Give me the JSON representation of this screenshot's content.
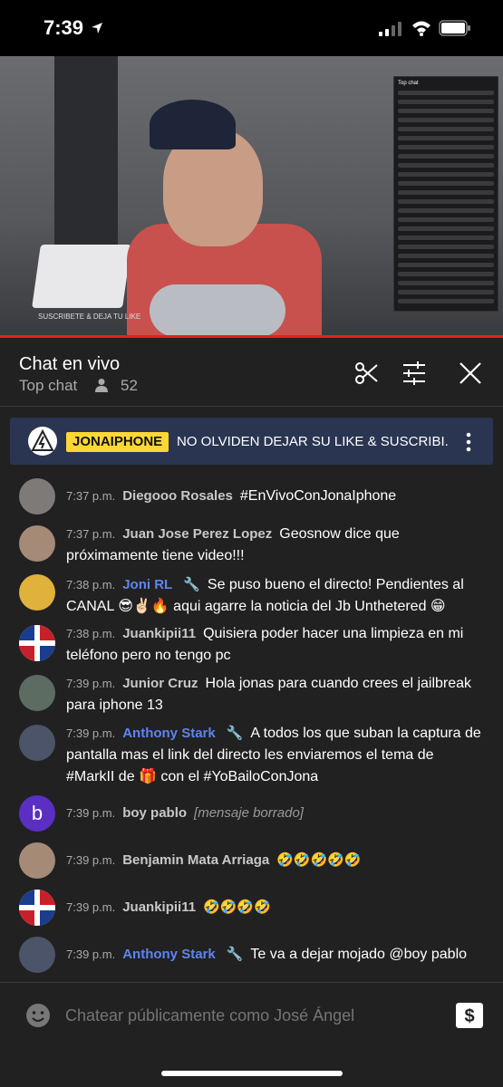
{
  "status_bar": {
    "time": "7:39"
  },
  "video": {
    "watermark": "SUSCRIBETE & DEJA TU LIKE",
    "overlay_title": "Top chat"
  },
  "chat_header": {
    "title": "Chat en vivo",
    "subtitle": "Top chat",
    "viewer_count": "52"
  },
  "pinned": {
    "badge": "JONAIPHONE",
    "text": "NO OLVIDEN DEJAR SU LIKE & SUSCRIBI..."
  },
  "messages": [
    {
      "time": "7:37 p.m.",
      "author": "Diegooo Rosales",
      "moderator": false,
      "text": "#EnVivoConJonaIphone",
      "avatar": "gray"
    },
    {
      "time": "7:37 p.m.",
      "author": "Juan Jose Perez Lopez",
      "moderator": false,
      "text": "Geosnow dice que próximamente tiene video!!!",
      "avatar": "couple"
    },
    {
      "time": "7:38 p.m.",
      "author": "Joni RL",
      "moderator": true,
      "text": "Se puso bueno el directo! Pendientes al CANAL 😎✌🏻🔥 aqui agarre la noticia del Jb Unthetered 😁",
      "avatar": "cartoon"
    },
    {
      "time": "7:38 p.m.",
      "author": "Juankipii11",
      "moderator": false,
      "text": "Quisiera poder hacer una limpieza en mi teléfono pero no tengo pc",
      "avatar": "flag"
    },
    {
      "time": "7:39 p.m.",
      "author": "Junior Cruz",
      "moderator": false,
      "text": "Hola jonas para cuando crees el jailbreak para iphone 13",
      "avatar": "cap"
    },
    {
      "time": "7:39 p.m.",
      "author": "Anthony Stark",
      "moderator": true,
      "text": "A todos los que suban la captura de pantalla mas el link del directo les enviaremos el tema de #MarkII de 🎁 con el #YoBailoConJona",
      "avatar": "suit"
    },
    {
      "time": "7:39 p.m.",
      "author": "boy pablo",
      "moderator": false,
      "text": "[mensaje borrado]",
      "deleted": true,
      "avatar": "b",
      "avatar_letter": "b"
    },
    {
      "time": "7:39 p.m.",
      "author": "Benjamin Mata Arriaga",
      "moderator": false,
      "text": "🤣🤣🤣🤣🤣",
      "avatar": "couple"
    },
    {
      "time": "7:39 p.m.",
      "author": "Juankipii11",
      "moderator": false,
      "text": "🤣🤣🤣🤣",
      "avatar": "flag"
    },
    {
      "time": "7:39 p.m.",
      "author": "Anthony Stark",
      "moderator": true,
      "text": "Te va a dejar mojado @boy pablo",
      "avatar": "suit"
    }
  ],
  "input": {
    "placeholder": "Chatear públicamente como José Ángel"
  },
  "colors": {
    "moderator": "#5e84f1",
    "pinned_bg": "#2a3552",
    "badge": "#fdd835",
    "progress": "#e62117"
  }
}
